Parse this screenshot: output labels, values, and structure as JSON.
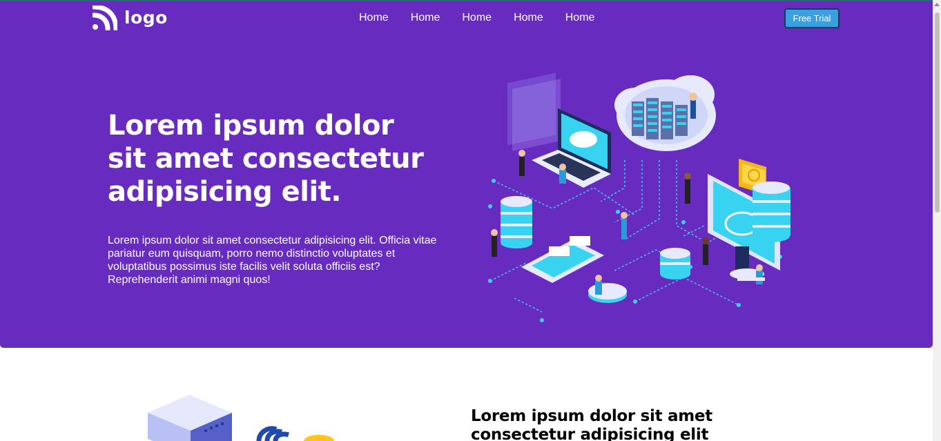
{
  "logo": {
    "text": "logo",
    "icon": "rss-wave-icon"
  },
  "nav": {
    "items": [
      "Home",
      "Home",
      "Home",
      "Home",
      "Home"
    ]
  },
  "cta": {
    "free_trial": "Free Trial"
  },
  "hero": {
    "title": "Lorem ipsum dolor sit amet consectetur adipisicing elit.",
    "text": "Lorem ipsum dolor sit amet consectetur adipisicing elit. Officia vitae pariatur eum quisquam, porro nemo distinctio voluptates et voluptatibus possimus iste facilis velit soluta officiis est? Reprehenderit animi magni quos!"
  },
  "section2": {
    "title": "Lorem ipsum dolor sit amet consectetur adipisicing elit"
  },
  "colors": {
    "hero_bg": "#672cbf",
    "accent": "#3aa0e0",
    "cyan": "#37d3f0"
  }
}
